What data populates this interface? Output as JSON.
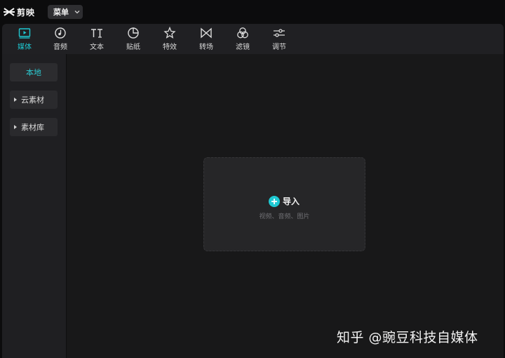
{
  "app": {
    "name": "剪映",
    "menu_label": "菜单"
  },
  "toolbar": {
    "tabs": [
      {
        "label": "媒体",
        "icon": "media-icon",
        "active": true
      },
      {
        "label": "音频",
        "icon": "audio-icon",
        "active": false
      },
      {
        "label": "文本",
        "icon": "text-icon",
        "active": false
      },
      {
        "label": "贴纸",
        "icon": "sticker-icon",
        "active": false
      },
      {
        "label": "特效",
        "icon": "effects-icon",
        "active": false
      },
      {
        "label": "转场",
        "icon": "transition-icon",
        "active": false
      },
      {
        "label": "滤镜",
        "icon": "filter-icon",
        "active": false
      },
      {
        "label": "调节",
        "icon": "adjust-icon",
        "active": false
      }
    ]
  },
  "sidebar": {
    "items": [
      {
        "label": "本地",
        "active": true
      },
      {
        "label": "云素材",
        "active": false
      },
      {
        "label": "素材库",
        "active": false
      }
    ]
  },
  "import": {
    "label": "导入",
    "hint": "视频、音频、图片"
  },
  "watermark": "知乎 @豌豆科技自媒体",
  "colors": {
    "accent": "#1ec8d2",
    "background": "#181819",
    "panel": "#202023"
  }
}
